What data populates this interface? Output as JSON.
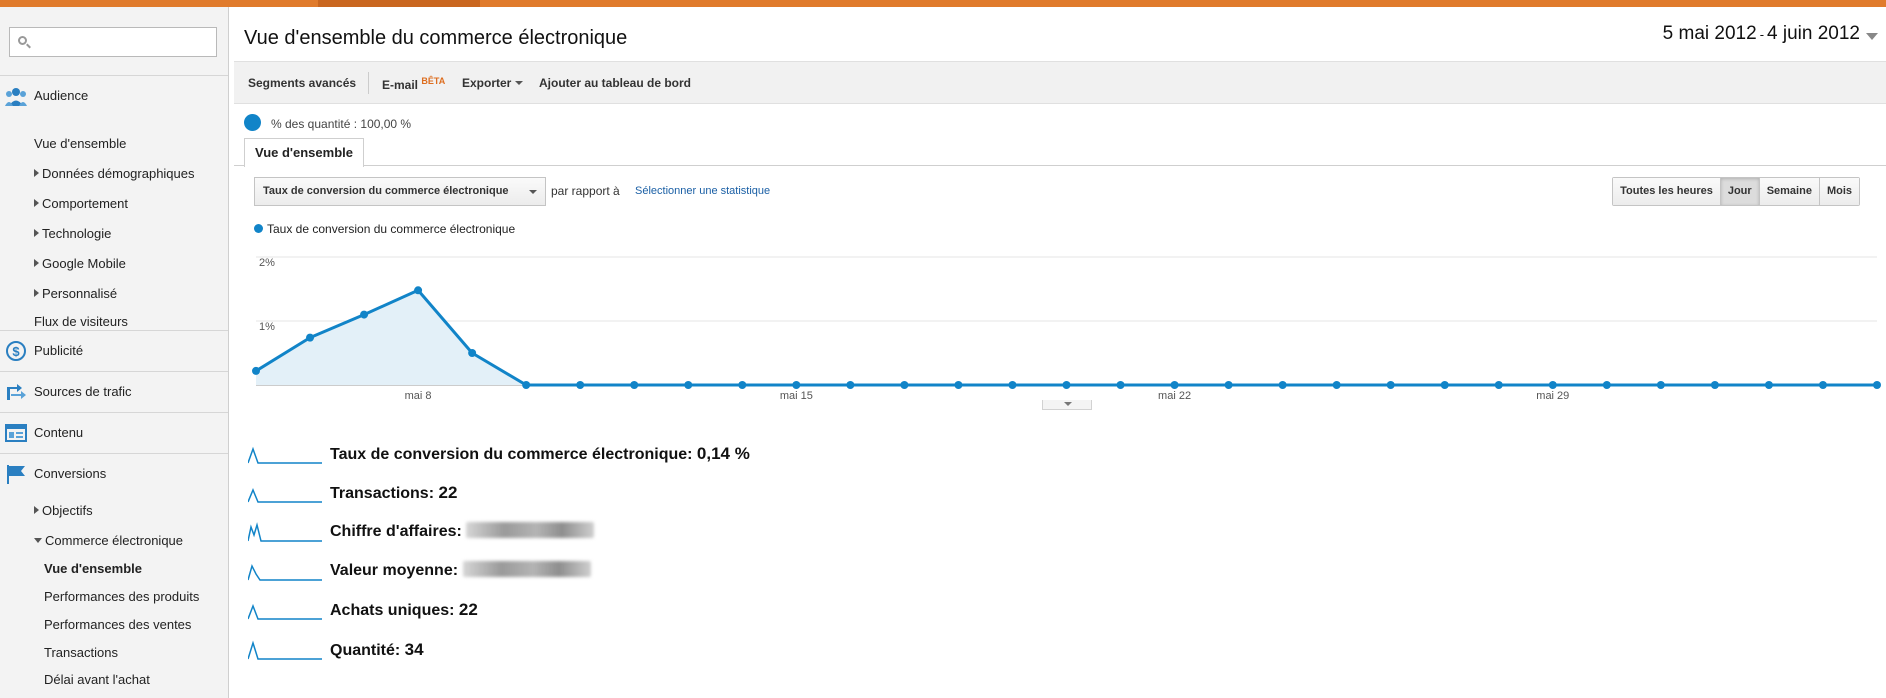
{
  "sidebar": {
    "search_placeholder": "",
    "sections": {
      "audience": "Audience",
      "advertising": "Publicité",
      "traffic": "Sources de trafic",
      "content": "Contenu",
      "conversions": "Conversions"
    },
    "audience_items": [
      "Vue d'ensemble",
      "Données démographiques",
      "Comportement",
      "Technologie",
      "Google Mobile",
      "Personnalisé",
      "Flux de visiteurs"
    ],
    "conversion_items": [
      "Objectifs",
      "Commerce électronique"
    ],
    "ecommerce_items": [
      "Vue d'ensemble",
      "Performances des produits",
      "Performances des ventes",
      "Transactions",
      "Délai avant l'achat"
    ]
  },
  "header": {
    "title": "Vue d'ensemble du commerce électronique",
    "date_start": "5 mai 2012",
    "date_sep": "-",
    "date_end": "4 juin 2012"
  },
  "toolbar": {
    "segments": "Segments avancés",
    "email": "E-mail",
    "beta": "BÊTA",
    "export": "Exporter",
    "add_dashboard": "Ajouter au tableau de bord"
  },
  "sampling": {
    "text": "% des quantité : 100,00 %"
  },
  "tabs": {
    "overview": "Vue d'ensemble"
  },
  "controls": {
    "metric": "Taux de conversion du commerce électronique",
    "versus": "par rapport à",
    "select_metric": "Sélectionner une statistique",
    "periods": [
      "Toutes les heures",
      "Jour",
      "Semaine",
      "Mois"
    ],
    "active_period": "Jour"
  },
  "chart_data": {
    "type": "area",
    "series": [
      {
        "name": "Taux de conversion du commerce électronique",
        "values": [
          0.22,
          0.74,
          1.1,
          1.48,
          0.5,
          0,
          0,
          0,
          0,
          0,
          0,
          0,
          0,
          0,
          0,
          0,
          0,
          0,
          0,
          0,
          0,
          0,
          0,
          0,
          0,
          0,
          0,
          0,
          0,
          0,
          0
        ]
      }
    ],
    "x": [
      "5 mai",
      "6 mai",
      "7 mai",
      "8 mai",
      "9 mai",
      "10 mai",
      "11 mai",
      "12 mai",
      "13 mai",
      "14 mai",
      "15 mai",
      "16 mai",
      "17 mai",
      "18 mai",
      "19 mai",
      "20 mai",
      "21 mai",
      "22 mai",
      "23 mai",
      "24 mai",
      "25 mai",
      "26 mai",
      "27 mai",
      "28 mai",
      "29 mai",
      "30 mai",
      "31 mai",
      "1 juin",
      "2 juin",
      "3 juin",
      "4 juin"
    ],
    "x_tick_labels": [
      {
        "label": "mai 8",
        "index": 3
      },
      {
        "label": "mai 15",
        "index": 10
      },
      {
        "label": "mai 22",
        "index": 17
      },
      {
        "label": "mai 29",
        "index": 24
      }
    ],
    "y_tick_labels": [
      {
        "label": "2%",
        "value": 2
      },
      {
        "label": "1%",
        "value": 1
      }
    ],
    "ylim": [
      0,
      2
    ],
    "color": "#1184c8",
    "fill": "#e3f0f8",
    "grid": true
  },
  "metrics": [
    {
      "label": "Taux de conversion du commerce électronique:",
      "value": "0,14 %"
    },
    {
      "label": "Transactions:",
      "value": "22"
    },
    {
      "label": "Chiffre d'affaires:",
      "value": "",
      "redacted": true
    },
    {
      "label": "Valeur moyenne:",
      "value": "",
      "redacted": true
    },
    {
      "label": "Achats uniques:",
      "value": "22"
    },
    {
      "label": "Quantité:",
      "value": "34"
    }
  ]
}
